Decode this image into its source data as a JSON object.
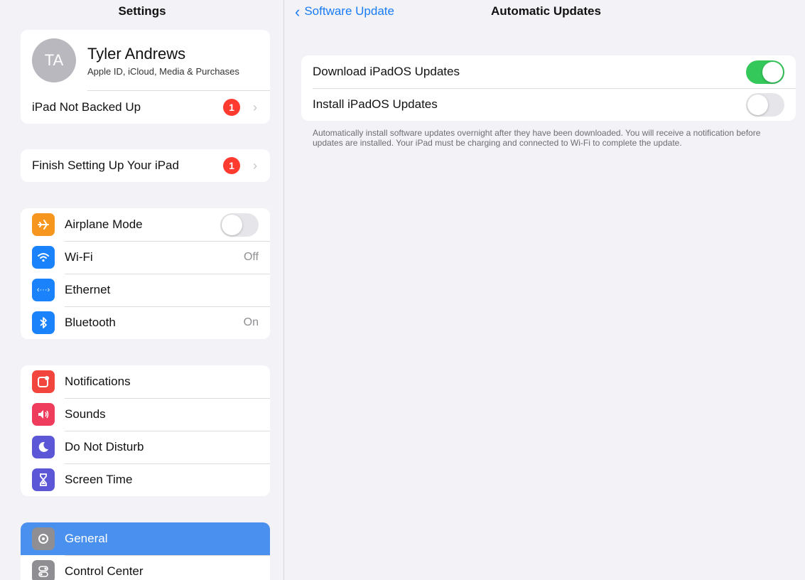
{
  "sidebar": {
    "title": "Settings",
    "profile": {
      "initials": "TA",
      "name": "Tyler Andrews",
      "subtitle": "Apple ID, iCloud, Media & Purchases"
    },
    "backup": {
      "label": "iPad Not Backed Up",
      "badge": "1"
    },
    "setup": {
      "label": "Finish Setting Up Your iPad",
      "badge": "1"
    },
    "network": [
      {
        "label": "Airplane Mode",
        "icon": "airplane-icon",
        "color": "#f7961e",
        "toggle": false
      },
      {
        "label": "Wi-Fi",
        "icon": "wifi-icon",
        "color": "#1a82fb",
        "value": "Off"
      },
      {
        "label": "Ethernet",
        "icon": "ethernet-icon",
        "color": "#1a82fb"
      },
      {
        "label": "Bluetooth",
        "icon": "bluetooth-icon",
        "color": "#1a82fb",
        "value": "On"
      }
    ],
    "alerts": [
      {
        "label": "Notifications",
        "icon": "notifications-icon",
        "color": "#f2453d"
      },
      {
        "label": "Sounds",
        "icon": "sounds-icon",
        "color": "#f03c5c"
      },
      {
        "label": "Do Not Disturb",
        "icon": "moon-icon",
        "color": "#5b57d6"
      },
      {
        "label": "Screen Time",
        "icon": "hourglass-icon",
        "color": "#5b57d6"
      }
    ],
    "system": [
      {
        "label": "General",
        "icon": "gear-icon",
        "color": "#8e8e93",
        "selected": true
      },
      {
        "label": "Control Center",
        "icon": "control-center-icon",
        "color": "#8e8e93"
      }
    ]
  },
  "main": {
    "back_label": "Software Update",
    "title": "Automatic Updates",
    "options": [
      {
        "label": "Download iPadOS Updates",
        "toggle": true
      },
      {
        "label": "Install iPadOS Updates",
        "toggle": false
      }
    ],
    "footnote": "Automatically install software updates overnight after they have been downloaded. You will receive a notification before updates are installed. Your iPad must be charging and connected to Wi-Fi to complete the update."
  },
  "colors": {
    "accent": "#1a7cf5",
    "toggle_on": "#34c759",
    "badge": "#ff3b30",
    "selected_row": "#4a90ef"
  }
}
